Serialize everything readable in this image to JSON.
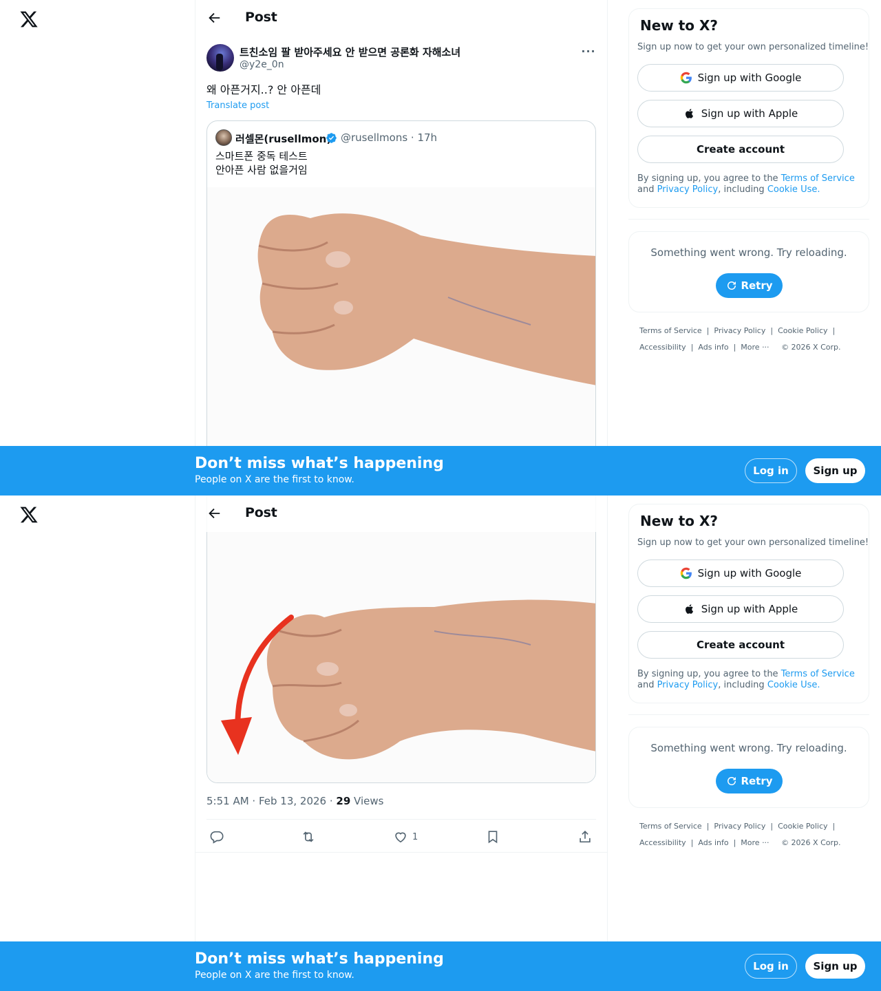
{
  "nav": {
    "logo_icon": "x-logo-icon",
    "back_icon": "arrow-left-icon",
    "title": "Post"
  },
  "post": {
    "author_name": "트친소임 팔 받아주세요 안 받으면 공론화 자해소녀",
    "author_handle": "@y2e_0n",
    "more_icon": "more-dots-icon",
    "more_label": "···",
    "text": "왜 아픈거지..? 안 아픈데",
    "translate": "Translate post",
    "timestamp": "5:51 AM · Feb 13, 2026 · ",
    "views_count": "29",
    "views_label": " Views",
    "like_count": "1"
  },
  "quote": {
    "author_name": "러셀몬(rusellmon)",
    "verified_icon": "verified-badge-icon",
    "meta": "@rusellmons · 17h",
    "line1": "스마트폰 중독 테스트",
    "line2": "안아픈 사람 없을거임"
  },
  "actions": {
    "reply_icon": "reply-icon",
    "repost_icon": "repost-icon",
    "like_icon": "heart-icon",
    "bookmark_icon": "bookmark-icon",
    "share_icon": "share-icon"
  },
  "sidebar": {
    "signup_title": "New to X?",
    "signup_sub": "Sign up now to get your own personalized timeline!",
    "google_label": "Sign up with Google",
    "apple_label": "Sign up with Apple",
    "create_label": "Create account",
    "terms_prefix": "By signing up, you agree to the ",
    "terms_tos": "Terms of Service",
    "terms_and": " and ",
    "terms_privacy": "Privacy Policy",
    "terms_including": ", including ",
    "terms_cookie": "Cookie Use.",
    "error_text": "Something went wrong. Try reloading.",
    "retry_label": "Retry"
  },
  "footer": {
    "tos": "Terms of Service",
    "privacy": "Privacy Policy",
    "cookie": "Cookie Policy",
    "accessibility": "Accessibility",
    "ads": "Ads info",
    "more": "More ···",
    "copyright": "© 2026 X Corp."
  },
  "banner": {
    "title": "Don’t miss what’s happening",
    "subtitle": "People on X are the first to know.",
    "login": "Log in",
    "signup": "Sign up"
  },
  "colors": {
    "brand_blue": "#1d9bf0",
    "text_primary": "#0f1419",
    "text_secondary": "#536471",
    "border": "#cfd9de",
    "arrow_red": "#e8321f",
    "skin": "#d9a88a"
  }
}
